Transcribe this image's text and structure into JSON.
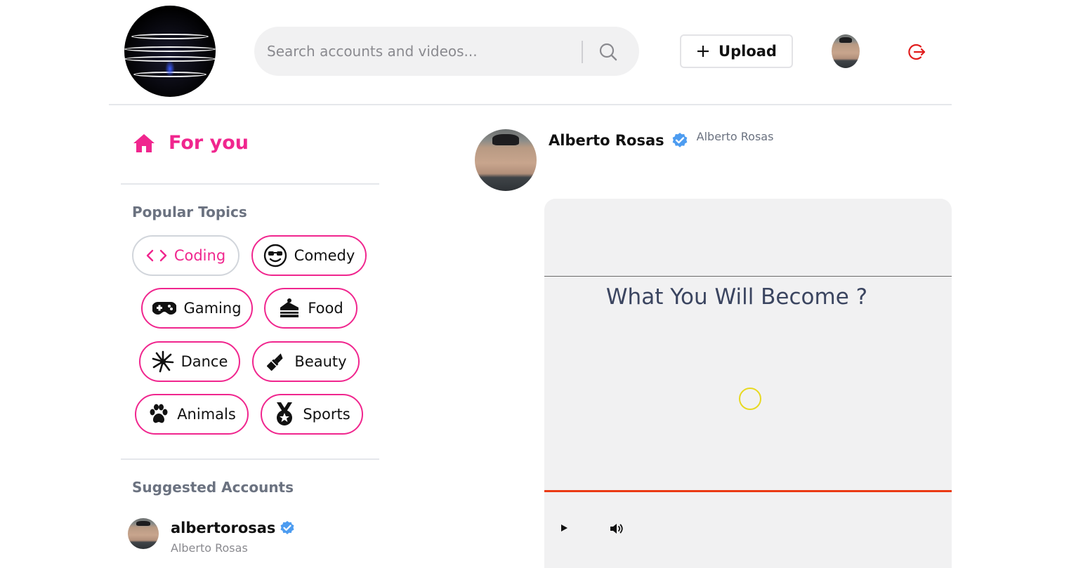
{
  "header": {
    "search": {
      "placeholder": "Search accounts and videos..."
    },
    "upload_label": "Upload",
    "upload_icon": "plus-icon",
    "logout_icon": "logout-icon",
    "logout_color": "#e11d1d"
  },
  "sidebar": {
    "for_you_label": "For you",
    "accent_color": "#f0268e",
    "popular_topics_title": "Popular Topics",
    "topics": [
      {
        "label": "Coding",
        "icon": "code-icon",
        "active": true
      },
      {
        "label": "Comedy",
        "icon": "sunglasses-face-icon",
        "active": false
      },
      {
        "label": "Gaming",
        "icon": "gamepad-icon",
        "active": false
      },
      {
        "label": "Food",
        "icon": "cake-slice-icon",
        "active": false
      },
      {
        "label": "Dance",
        "icon": "splash-icon",
        "active": false
      },
      {
        "label": "Beauty",
        "icon": "lipstick-icon",
        "active": false
      },
      {
        "label": "Animals",
        "icon": "paw-icon",
        "active": false
      },
      {
        "label": "Sports",
        "icon": "medal-icon",
        "active": false
      }
    ],
    "suggested_title": "Suggested Accounts",
    "suggested": [
      {
        "username": "albertorosas",
        "name": "Alberto Rosas",
        "verified": true
      }
    ]
  },
  "post": {
    "author_name": "Alberto Rosas",
    "author_sub": "Alberto Rosas",
    "verified": true,
    "video_caption": "What You Will Become ?",
    "progress_color": "#ea3a14"
  }
}
